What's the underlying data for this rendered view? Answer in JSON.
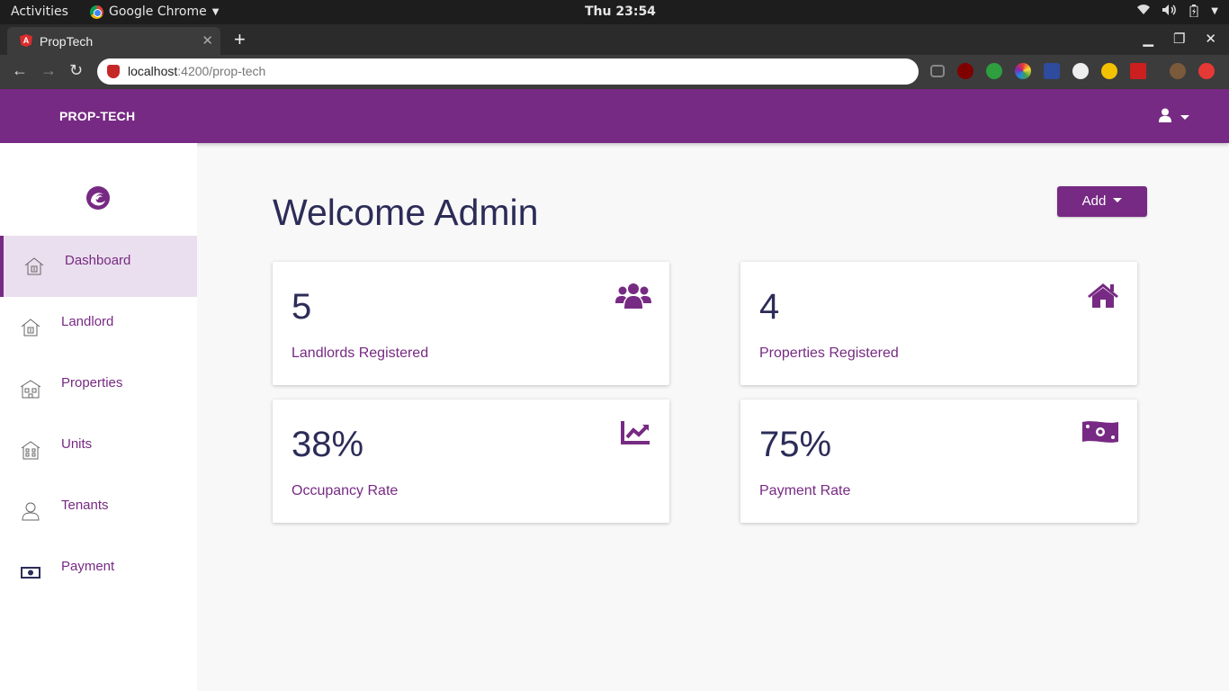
{
  "os": {
    "activities": "Activities",
    "app_name": "Google Chrome",
    "clock": "Thu 23:54"
  },
  "browser": {
    "tab_title": "PropTech",
    "url_host": "localhost",
    "url_path": ":4200/prop-tech"
  },
  "header": {
    "brand": "PROP-TECH"
  },
  "sidebar": {
    "items": [
      {
        "label": "Dashboard",
        "icon": "dashboard-house-icon",
        "active": true
      },
      {
        "label": "Landlord",
        "icon": "landlord-house-icon",
        "active": false
      },
      {
        "label": "Properties",
        "icon": "properties-building-icon",
        "active": false
      },
      {
        "label": "Units",
        "icon": "units-building-icon",
        "active": false
      },
      {
        "label": "Tenants",
        "icon": "tenant-person-icon",
        "active": false
      },
      {
        "label": "Payment",
        "icon": "payment-money-icon",
        "active": false
      }
    ]
  },
  "main": {
    "welcome": "Welcome Admin",
    "add_label": "Add",
    "cards": [
      {
        "value": "5",
        "caption": "Landlords Registered",
        "icon": "users-icon"
      },
      {
        "value": "4",
        "caption": "Properties Registered",
        "icon": "home-icon"
      },
      {
        "value": "38%",
        "caption": "Occupancy Rate",
        "icon": "chart-line-icon"
      },
      {
        "value": "75%",
        "caption": "Payment Rate",
        "icon": "money-bill-icon"
      }
    ]
  },
  "colors": {
    "primary": "#772a83",
    "heading": "#2c2c58",
    "active_bg": "#eadfee"
  }
}
